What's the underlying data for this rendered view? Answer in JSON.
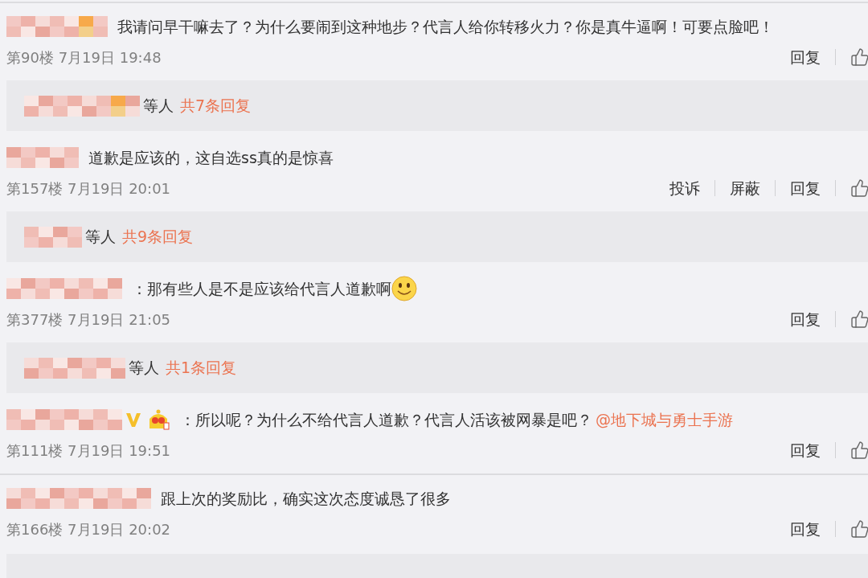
{
  "comments": [
    {
      "text": "我请问早干嘛去了？为什么要闹到这种地步？代言人给你转移火力？你是真牛逼啊！可要点脸吧！",
      "meta": "第90楼 7月19日 19:48",
      "actions": [
        "回复"
      ],
      "replies": {
        "suffix": "等人",
        "count": "共7条回复"
      }
    },
    {
      "text": "道歉是应该的，这自选ss真的是惊喜",
      "meta": "第157楼 7月19日 20:01",
      "actions": [
        "投诉",
        "屏蔽",
        "回复"
      ],
      "replies": {
        "suffix": "等人",
        "count": "共9条回复"
      }
    },
    {
      "text": "：那有些人是不是应该给代言人道歉啊",
      "emoji": true,
      "meta": "第377楼 7月19日 21:05",
      "actions": [
        "回复"
      ],
      "replies": {
        "suffix": "等人",
        "count": "共1条回复"
      }
    },
    {
      "text": "：所以呢？为什么不给代言人道歉？代言人活该被网暴是吧？",
      "mention": "@地下城与勇士手游",
      "badges": [
        {
          "kind": "verified"
        },
        {
          "kind": "crown"
        }
      ],
      "meta": "第111楼 7月19日 19:51",
      "actions": [
        "回复"
      ]
    },
    {
      "text": "跟上次的奖励比，确实这次态度诚恳了很多",
      "meta": "第166楼 7月19日 20:02",
      "actions": [
        "回复"
      ],
      "replies_cut": true
    }
  ]
}
